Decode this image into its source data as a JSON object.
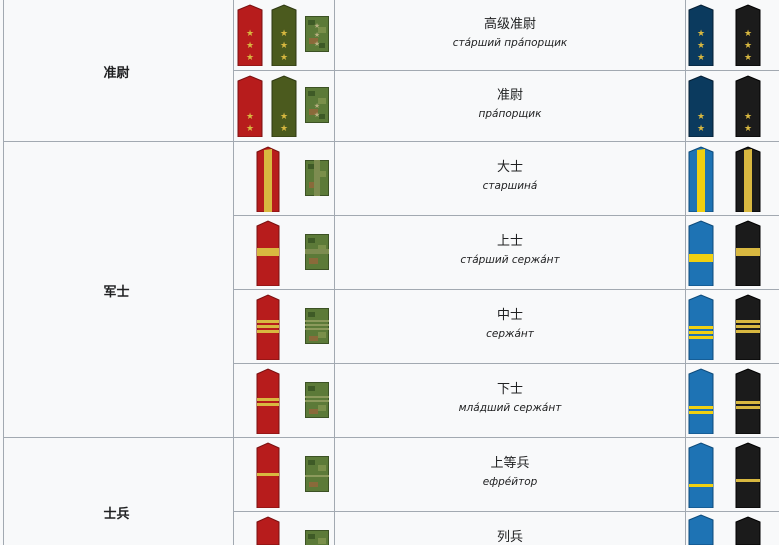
{
  "colors": {
    "border": "#a2a9b1",
    "background": "#f8f9fa",
    "army_red": "#b71c1c",
    "army_green": "#4b5a1e",
    "camo": "#5c7a38",
    "navy_blue": "#0b3a5e",
    "sky_blue": "#1e73b4",
    "black": "#1b1b1b",
    "gold": "#d8b840",
    "yellow": "#f0d010"
  },
  "categories": [
    {
      "label": "准尉"
    },
    {
      "label": "军士"
    },
    {
      "label": "士兵"
    }
  ],
  "ranks": [
    {
      "zh": "高级准尉",
      "ru": "ста́рший пра́порщик",
      "insignia": "three-stars"
    },
    {
      "zh": "准尉",
      "ru": "пра́порщик",
      "insignia": "two-stars"
    },
    {
      "zh": "大士",
      "ru": "старшина́",
      "insignia": "wide-lengthwise-stripe"
    },
    {
      "zh": "上士",
      "ru": "ста́рший сержа́нт",
      "insignia": "wide-crosswise-stripe"
    },
    {
      "zh": "中士",
      "ru": "сержа́нт",
      "insignia": "three-narrow-stripes"
    },
    {
      "zh": "下士",
      "ru": "мла́дший сержа́нт",
      "insignia": "two-narrow-stripes"
    },
    {
      "zh": "上等兵",
      "ru": "ефре́йтор",
      "insignia": "one-narrow-stripe"
    },
    {
      "zh": "列兵",
      "ru": "",
      "insignia": "plain"
    }
  ]
}
